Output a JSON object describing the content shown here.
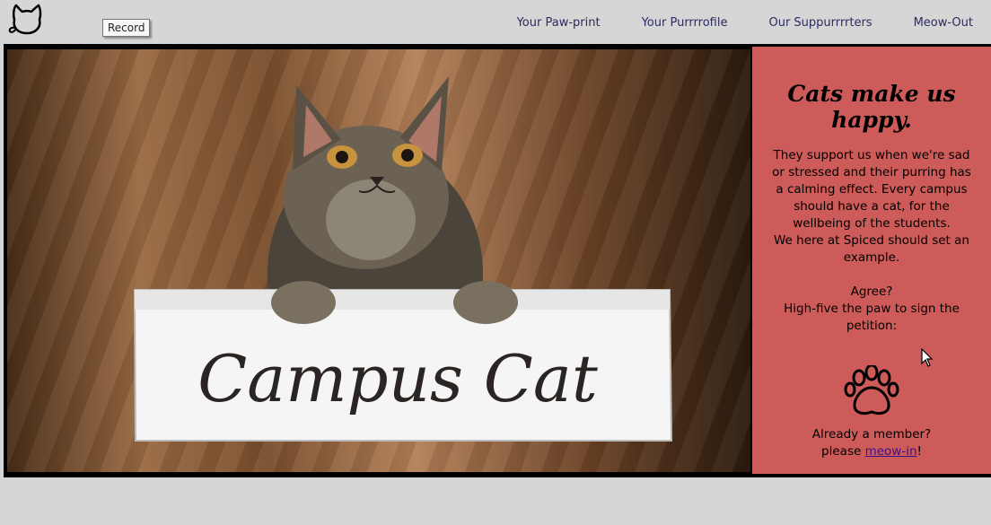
{
  "tooltip": {
    "text": "Record"
  },
  "nav": {
    "items": [
      {
        "label": "Your Paw-print"
      },
      {
        "label": "Your Purrrrofile"
      },
      {
        "label": "Our Suppurrrrters"
      },
      {
        "label": "Meow-Out"
      }
    ]
  },
  "hero": {
    "sign_text": "Campus Cat",
    "image_icon": "cat-holding-sign-photo"
  },
  "sidebar": {
    "heading": "Cats make us happy.",
    "text_lines": [
      "They support us when we're sad",
      "or stressed and their purring has",
      "a calming effect. Every campus",
      "should have a cat, for the",
      "wellbeing of the students.",
      "We here at Spiced should set an",
      "example."
    ],
    "agree": "Agree?",
    "instruction_lines": [
      "High-five the paw to sign the",
      "petition:"
    ],
    "member_question": "Already a member?",
    "please_prefix": "please",
    "login_link": "meow-in",
    "login_suffix": "!"
  },
  "colors": {
    "background": "#d6d6d6",
    "sidebar": "#cd5b59",
    "nav_text": "#2a2c5e",
    "link": "#3a0f8a"
  },
  "icons": {
    "logo": "cat-outline-icon",
    "paw": "paw-print-icon",
    "cursor": "mouse-pointer-icon"
  }
}
